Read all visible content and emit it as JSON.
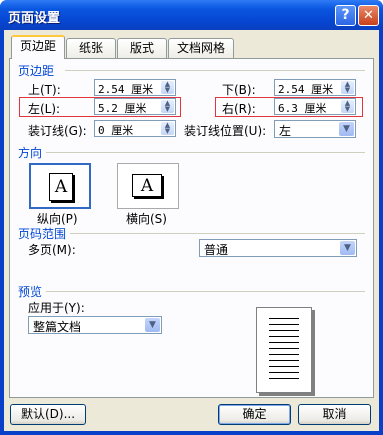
{
  "title": "页面设置",
  "titlebar": {
    "help": "?",
    "close": "✕"
  },
  "tabs": [
    "页边距",
    "纸张",
    "版式",
    "文档网格"
  ],
  "margins": {
    "section": "页边距",
    "top_label": "上(T):",
    "top_value": "2.54 厘米",
    "bottom_label": "下(B):",
    "bottom_value": "2.54 厘米",
    "left_label": "左(L):",
    "left_value": "5.2 厘米",
    "right_label": "右(R):",
    "right_value": "6.3 厘米",
    "gutter_label": "装订线(G):",
    "gutter_value": "0 厘米",
    "gutter_pos_label": "装订线位置(U):",
    "gutter_pos_value": "左"
  },
  "orientation": {
    "section": "方向",
    "portrait": "纵向(P)",
    "landscape": "横向(S)",
    "glyph": "A",
    "selected": "portrait"
  },
  "pages": {
    "section": "页码范围",
    "multi_label": "多页(M):",
    "multi_value": "普通"
  },
  "preview": {
    "section": "预览",
    "apply_label": "应用于(Y):",
    "apply_value": "整篇文档"
  },
  "buttons": {
    "default": "默认(D)...",
    "ok": "确定",
    "cancel": "取消"
  },
  "colors": {
    "accent": "#0046d5",
    "highlight": "#e0353a",
    "titlebar": "#0a56e0"
  }
}
